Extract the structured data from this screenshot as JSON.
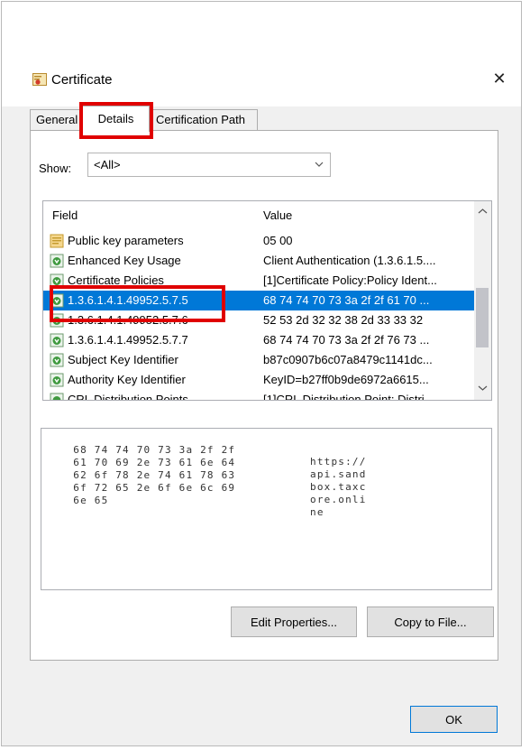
{
  "window": {
    "title": "Certificate",
    "close_glyph": "✕"
  },
  "tabs": [
    {
      "label": "General"
    },
    {
      "label": "Details"
    },
    {
      "label": "Certification Path"
    }
  ],
  "show": {
    "label": "Show:",
    "value": "<All>"
  },
  "list": {
    "headers": {
      "field": "Field",
      "value": "Value"
    },
    "rows": [
      {
        "field": "Public key parameters",
        "value": "05 00",
        "icon": "document-icon"
      },
      {
        "field": "Enhanced Key Usage",
        "value": "Client Authentication (1.3.6.1.5....",
        "icon": "extension-icon"
      },
      {
        "field": "Certificate Policies",
        "value": "[1]Certificate Policy:Policy Ident...",
        "icon": "extension-icon"
      },
      {
        "field": "1.3.6.1.4.1.49952.5.7.5",
        "value": "68 74 74 70 73 3a 2f 2f 61 70 ...",
        "icon": "extension-icon",
        "selected": true
      },
      {
        "field": "1.3.6.1.4.1.49952.5.7.6",
        "value": "52 53 2d 32 32 38 2d 33 33 32",
        "icon": "extension-icon"
      },
      {
        "field": "1.3.6.1.4.1.49952.5.7.7",
        "value": "68 74 74 70 73 3a 2f 2f 76 73 ...",
        "icon": "extension-icon"
      },
      {
        "field": "Subject Key Identifier",
        "value": "b87c0907b6c07a8479c1141dc...",
        "icon": "extension-icon"
      },
      {
        "field": "Authority Key Identifier",
        "value": "KeyID=b27ff0b9de6972a6615...",
        "icon": "extension-icon"
      },
      {
        "field": "CRL Distribution Points",
        "value": "[1]CRL Distribution Point: Distri...",
        "icon": "extension-icon"
      }
    ]
  },
  "hex": {
    "lines": [
      {
        "hex": "68 74 74 70 73 3a 2f 2f",
        "ascii": "https://"
      },
      {
        "hex": "61 70 69 2e 73 61 6e 64",
        "ascii": "api.sand"
      },
      {
        "hex": "62 6f 78 2e 74 61 78 63",
        "ascii": "box.taxc"
      },
      {
        "hex": "6f 72 65 2e 6f 6e 6c 69",
        "ascii": "ore.onli"
      },
      {
        "hex": "6e 65",
        "ascii": "ne"
      }
    ]
  },
  "buttons": {
    "edit_properties": "Edit Properties...",
    "copy_to_file": "Copy to File...",
    "ok": "OK"
  },
  "colors": {
    "selection": "#0078d7",
    "highlight_box": "#e00000"
  }
}
